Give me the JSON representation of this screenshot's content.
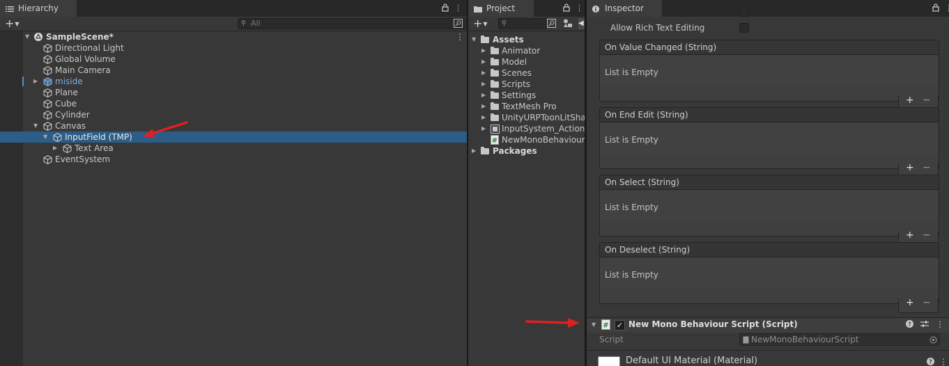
{
  "hierarchy": {
    "tab_label": "Hierarchy",
    "search_placeholder": "All",
    "scene_name": "SampleScene*",
    "items": [
      {
        "label": "Directional Light"
      },
      {
        "label": "Global Volume"
      },
      {
        "label": "Main Camera"
      },
      {
        "label": "miside"
      },
      {
        "label": "Plane"
      },
      {
        "label": "Cube"
      },
      {
        "label": "Cylinder"
      },
      {
        "label": "Canvas"
      },
      {
        "label": "InputField (TMP)"
      },
      {
        "label": "Text Area"
      },
      {
        "label": "EventSystem"
      }
    ]
  },
  "project": {
    "tab_label": "Project",
    "assets_label": "Assets",
    "folders": [
      {
        "label": "Animator"
      },
      {
        "label": "Model"
      },
      {
        "label": "Scenes"
      },
      {
        "label": "Scripts"
      },
      {
        "label": "Settings"
      },
      {
        "label": "TextMesh Pro"
      },
      {
        "label": "UnityURPToonLitShader"
      },
      {
        "label": "InputSystem_Actions"
      },
      {
        "label": "NewMonoBehaviourScript"
      }
    ],
    "packages_label": "Packages"
  },
  "inspector": {
    "tab_label": "Inspector",
    "allow_rich_text_label": "Allow Rich Text Editing",
    "events": [
      {
        "title": "On Value Changed (String)",
        "body": "List is Empty"
      },
      {
        "title": "On End Edit (String)",
        "body": "List is Empty"
      },
      {
        "title": "On Select (String)",
        "body": "List is Empty"
      },
      {
        "title": "On Deselect (String)",
        "body": "List is Empty"
      }
    ],
    "add_symbol": "+",
    "remove_symbol": "−",
    "component_title": "New Mono Behaviour Script (Script)",
    "script_label": "Script",
    "script_value": "NewMonoBehaviourScript",
    "material_title": "Default UI Material (Material)"
  },
  "colors": {
    "selection": "#2c5d87",
    "annotation_arrow": "#e02020",
    "prefab_blue": "#7baee0"
  }
}
